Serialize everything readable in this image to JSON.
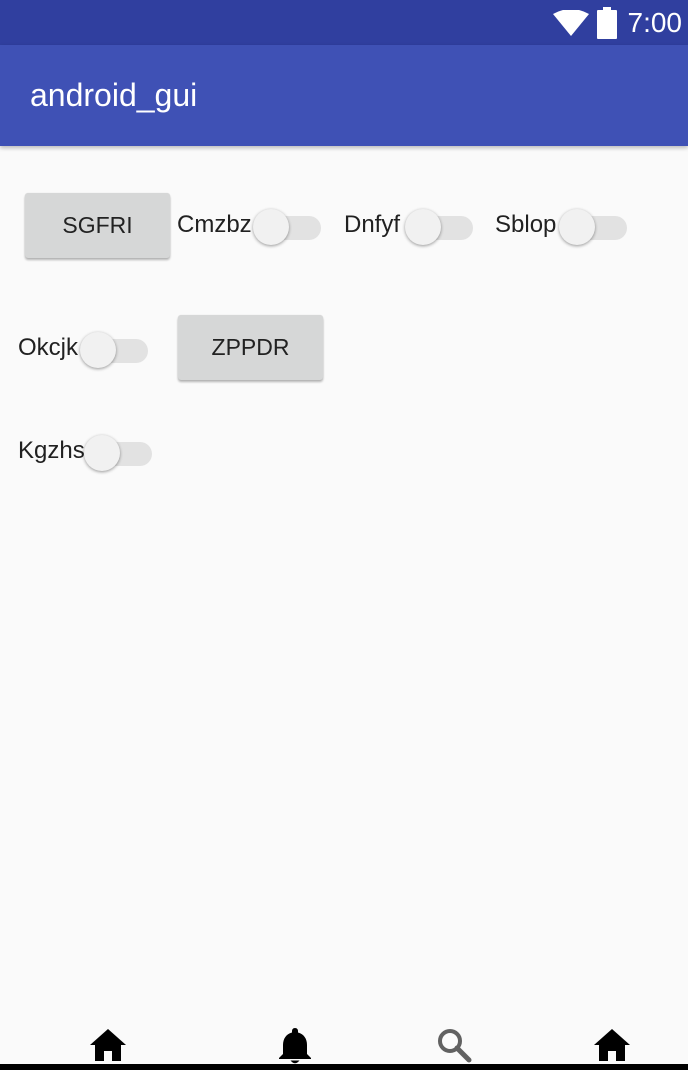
{
  "status_bar": {
    "time": "7:00",
    "icons": [
      "wifi-icon",
      "battery-icon"
    ]
  },
  "app_bar": {
    "title": "android_gui"
  },
  "controls": {
    "button_sgfri": "SGFRI",
    "button_zppdr": "ZPPDR",
    "switch_cmzbz": {
      "label": "Cmzbz",
      "checked": false
    },
    "switch_dnfyf": {
      "label": "Dnfyf",
      "checked": false
    },
    "switch_sblop": {
      "label": "Sblop",
      "checked": false
    },
    "switch_okcjk": {
      "label": "Okcjk",
      "checked": false
    },
    "switch_kgzhs": {
      "label": "Kgzhs",
      "checked": false
    }
  },
  "bottom_nav": {
    "items": [
      "home-icon",
      "bell-icon",
      "search-icon",
      "home-icon"
    ]
  },
  "colors": {
    "status_bar": "#303f9f",
    "app_bar": "#3f51b5",
    "background": "#fafafa",
    "button": "#d6d7d7"
  }
}
